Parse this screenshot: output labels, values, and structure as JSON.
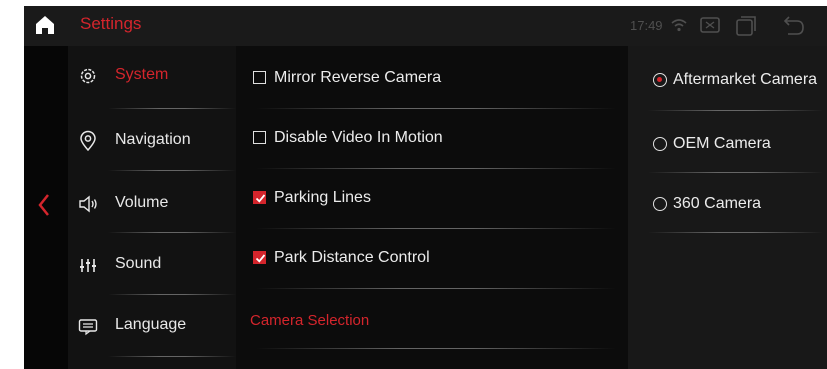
{
  "header": {
    "title": "Settings",
    "time": "17:49",
    "icons": [
      "home-icon",
      "wifi-icon",
      "screen-mirror-icon",
      "window-icon",
      "back-arrow-icon"
    ]
  },
  "sidebar": {
    "items": [
      {
        "label": "System",
        "icon": "gear-icon",
        "active": true
      },
      {
        "label": "Navigation",
        "icon": "location-pin-icon",
        "active": false
      },
      {
        "label": "Volume",
        "icon": "speaker-icon",
        "active": false
      },
      {
        "label": "Sound",
        "icon": "equalizer-icon",
        "active": false
      },
      {
        "label": "Language",
        "icon": "keyboard-icon",
        "active": false
      }
    ]
  },
  "options": [
    {
      "label": "Mirror Reverse Camera",
      "checked": false
    },
    {
      "label": "Disable Video In Motion",
      "checked": false
    },
    {
      "label": "Parking Lines",
      "checked": true
    },
    {
      "label": "Park Distance Control",
      "checked": true
    }
  ],
  "section_header": "Camera Selection",
  "camera_options": [
    {
      "label": "Aftermarket Camera",
      "selected": true
    },
    {
      "label": "OEM Camera",
      "selected": false
    },
    {
      "label": "360 Camera",
      "selected": false
    }
  ],
  "colors": {
    "accent": "#d4252c",
    "background": "#0c0c0c",
    "panel": "#181818",
    "text": "#ececec"
  }
}
